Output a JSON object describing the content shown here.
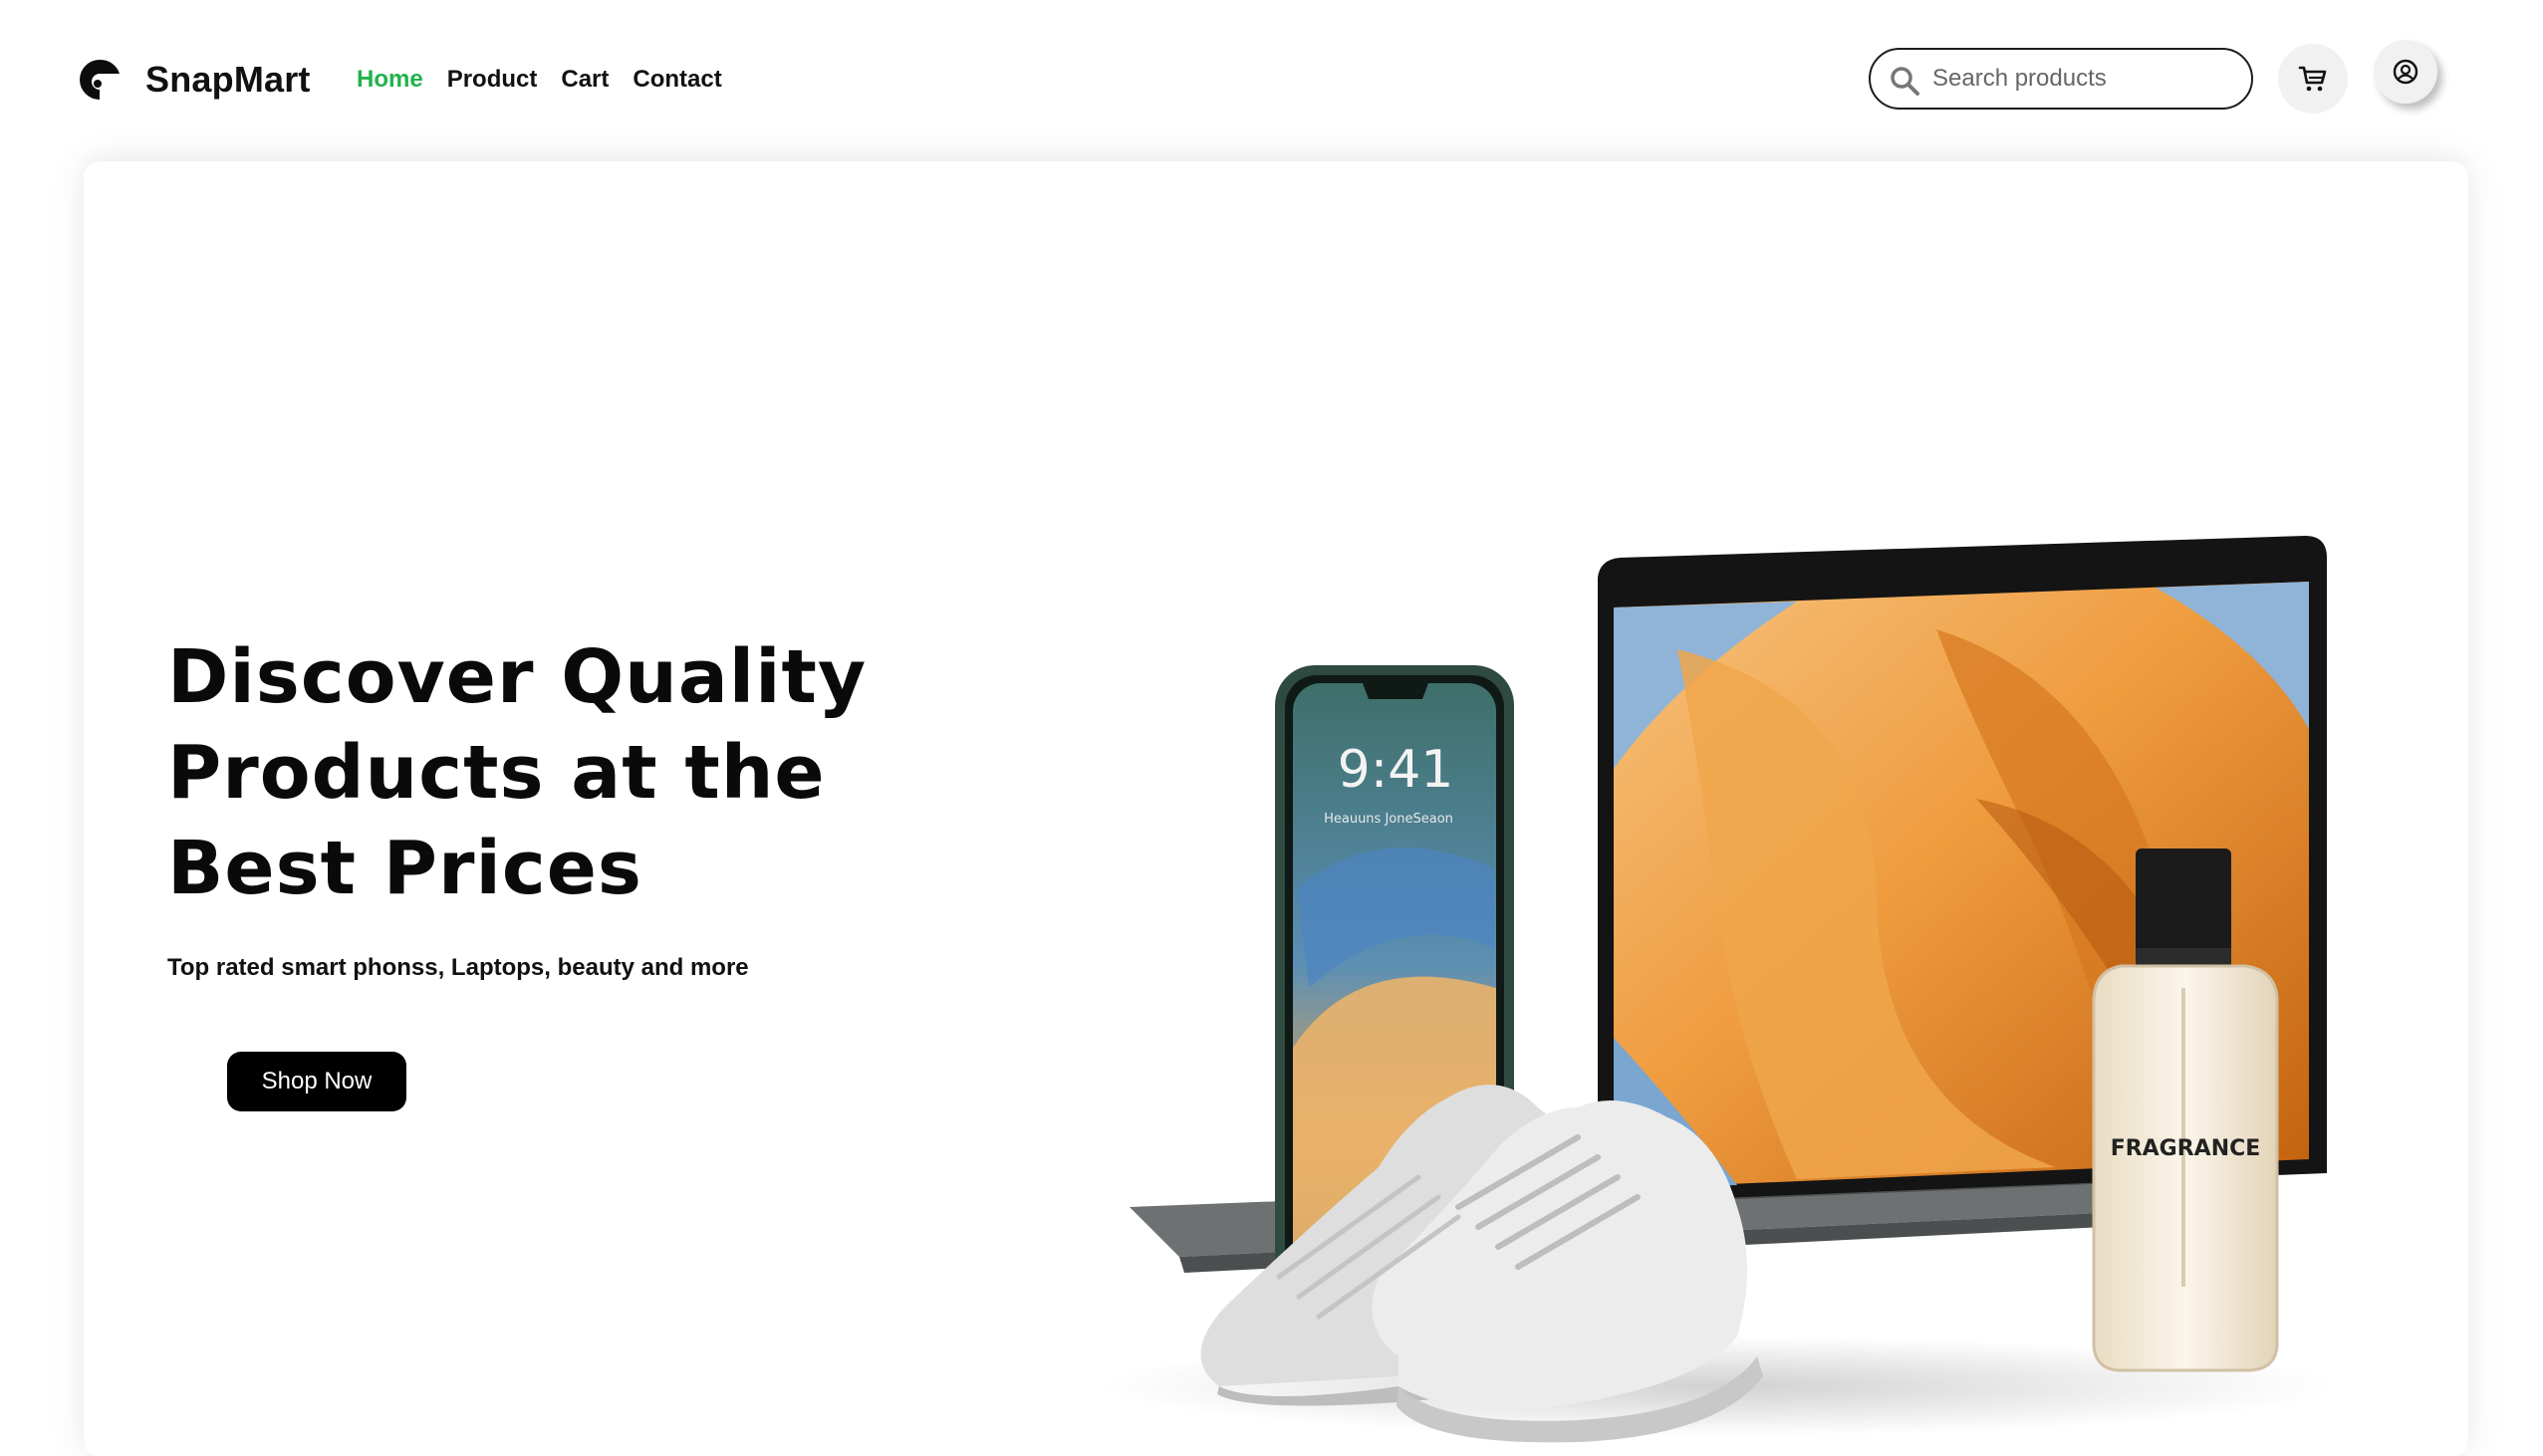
{
  "header": {
    "brand": "SnapMart",
    "nav": [
      {
        "label": "Home",
        "active": true
      },
      {
        "label": "Product",
        "active": false
      },
      {
        "label": "Cart",
        "active": false
      },
      {
        "label": "Contact",
        "active": false
      }
    ],
    "search_placeholder": "Search products",
    "cart_icon": "cart-icon",
    "user_icon": "user-circle-icon"
  },
  "hero": {
    "title": "Discover Quality Products at the Best Prices",
    "subtitle": "Top rated smart phonss, Laptops, beauty and more",
    "cta_label": "Shop Now"
  },
  "product_image": {
    "phone_time": "9:41",
    "perfume_label": "FRAGRANCE"
  },
  "colors": {
    "accent": "#22b24c",
    "text": "#111111",
    "button_bg": "#000000",
    "laptop_screen": "#e88a2a"
  }
}
